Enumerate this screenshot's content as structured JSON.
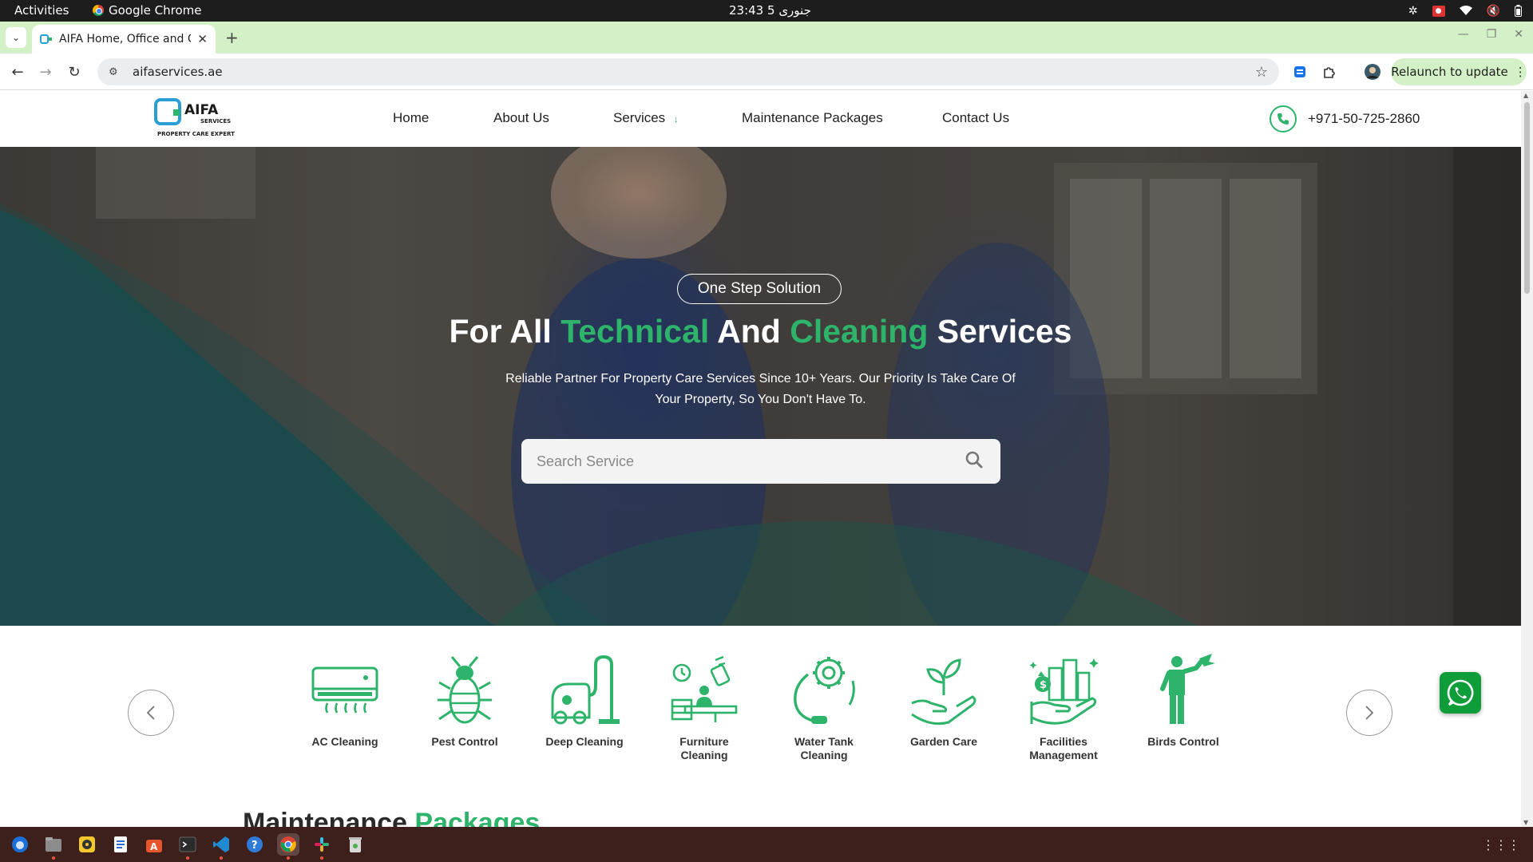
{
  "os": {
    "activities": "Activities",
    "app_name": "Google Chrome",
    "clock": "23:43  5 جنوری"
  },
  "browser": {
    "tab_title": "AIFA Home, Office and C",
    "url": "aifaservices.ae",
    "relaunch_label": "Relaunch to update"
  },
  "site": {
    "logo": {
      "brand": "AIFA",
      "brand_sub": "SERVICES",
      "tagline": "PROPERTY CARE EXPERT"
    },
    "nav": {
      "home": "Home",
      "about": "About Us",
      "services": "Services",
      "services_arrow": "↓",
      "packages": "Maintenance Packages",
      "contact": "Contact Us"
    },
    "phone": "+971-50-725-2860",
    "hero": {
      "badge": "One Step Solution",
      "headline": {
        "part1": "For All ",
        "highlight1": "Technical",
        "part2": " And ",
        "highlight2": "Cleaning",
        "part3": " Services"
      },
      "subtitle": "Reliable Partner For Property Care Services Since 10+ Years. Our Priority Is Take Care Of Your Property, So You Don't Have To.",
      "search_placeholder": "Search Service"
    },
    "services": [
      {
        "label": "AC Cleaning",
        "icon": "ac-unit-icon"
      },
      {
        "label": "Pest Control",
        "icon": "bug-icon"
      },
      {
        "label": "Deep Cleaning",
        "icon": "vacuum-icon"
      },
      {
        "label": "Furniture Cleaning",
        "icon": "furniture-cleaning-icon"
      },
      {
        "label": "Water Tank Cleaning",
        "icon": "water-tank-icon"
      },
      {
        "label": "Garden Care",
        "icon": "plant-hand-icon"
      },
      {
        "label": "Facilities Management",
        "icon": "facilities-icon"
      },
      {
        "label": "Birds Control",
        "icon": "bird-control-icon"
      }
    ],
    "section_title": {
      "part1": "Maintenance ",
      "highlight": "Packages"
    }
  },
  "colors": {
    "brand_green": "#2db36a",
    "tab_strip": "#d3f0c6",
    "taskbar": "#3d1f1b",
    "whatsapp": "#0f9d3a"
  }
}
